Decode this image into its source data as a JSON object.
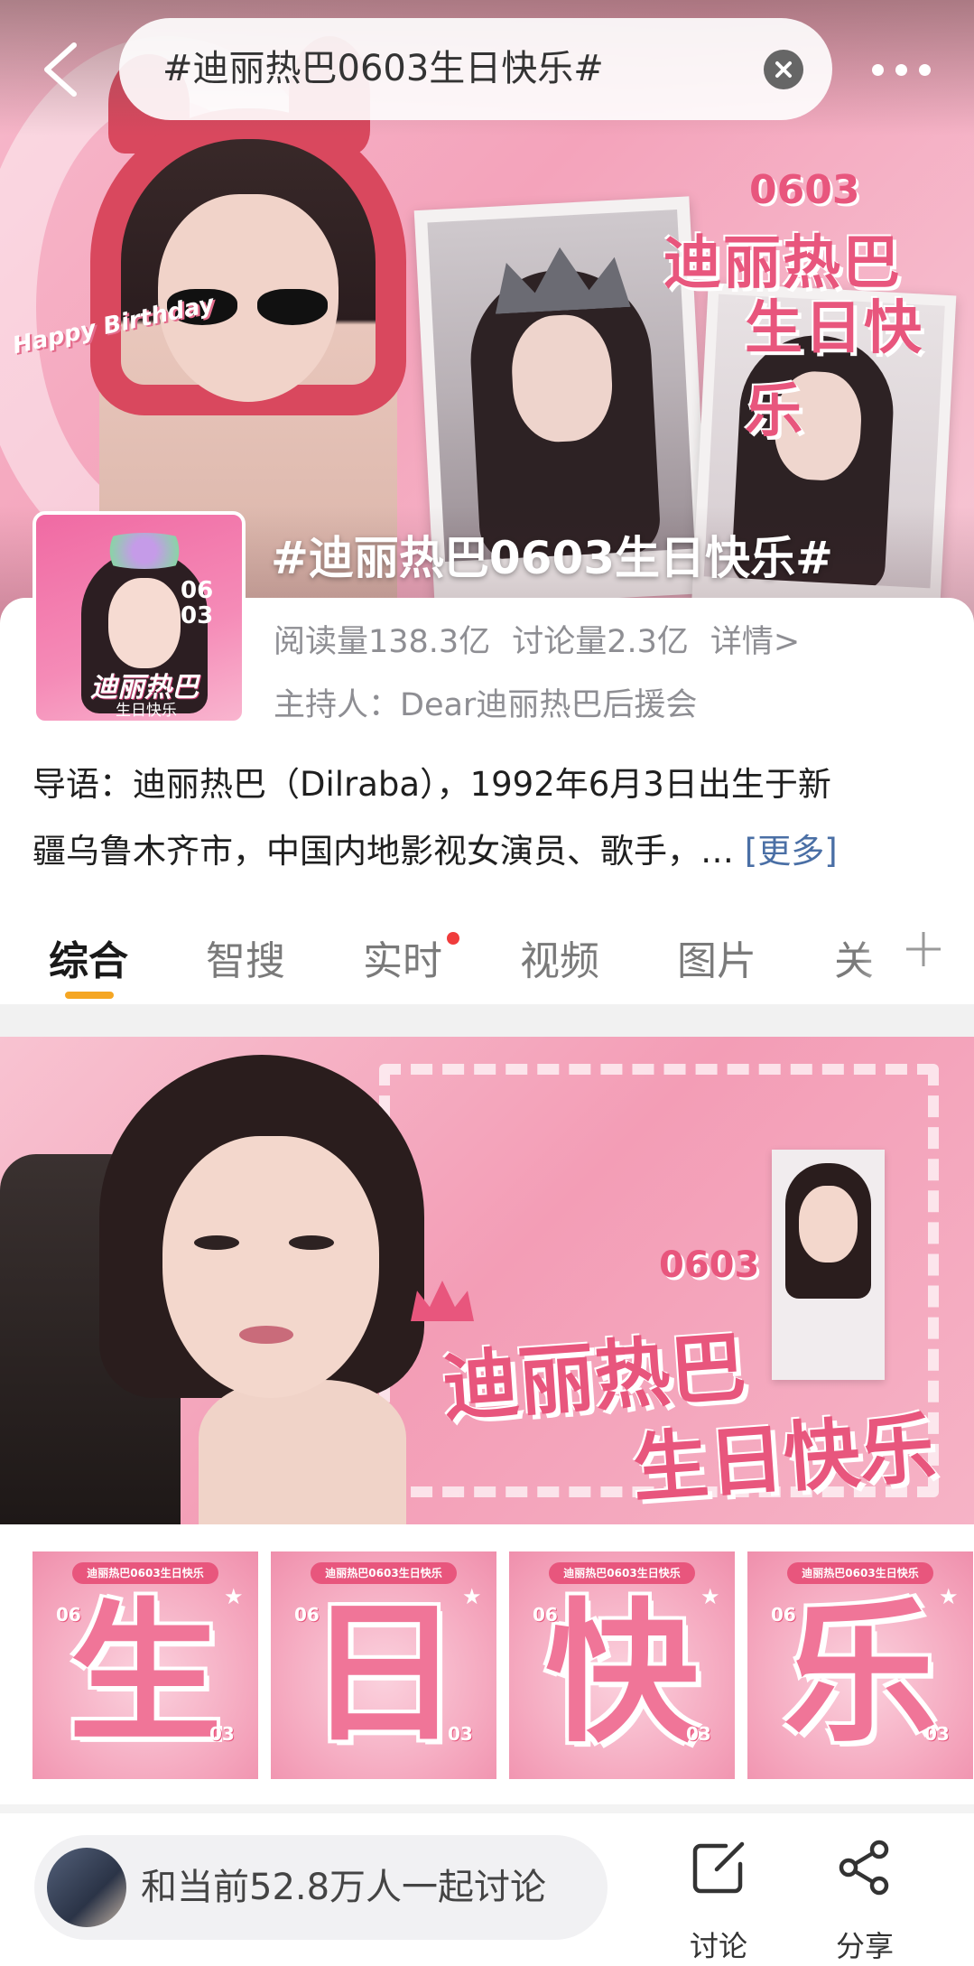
{
  "search": {
    "query": "#迪丽热巴0603生日快乐#"
  },
  "hero": {
    "happy_birthday": "Happy Birthday",
    "number": "0603",
    "title_line1": "迪丽热巴",
    "title_line2": "生日快乐"
  },
  "topic": {
    "title": "#迪丽热巴0603生日快乐#",
    "avatar_number": "06\n03",
    "avatar_name": "迪丽热巴",
    "avatar_sub": "生日快乐",
    "reads": "阅读量138.3亿",
    "discussions": "讨论量2.3亿",
    "details_link": "详情>",
    "host": "主持人：Dear迪丽热巴后援会",
    "intro_line1": "导语：迪丽热巴（Dilraba），1992年6月3日出生于新",
    "intro_line2": "疆乌鲁木齐市，中国内地影视女演员、歌手，…",
    "more_label": "[更多]"
  },
  "tabs": [
    {
      "label": "综合",
      "active": true
    },
    {
      "label": "智搜",
      "active": false
    },
    {
      "label": "实时",
      "active": false,
      "dot": true
    },
    {
      "label": "视频",
      "active": false
    },
    {
      "label": "图片",
      "active": false
    },
    {
      "label": "关",
      "active": false
    }
  ],
  "tab_add": "+",
  "banner": {
    "number": "0603",
    "title_line1": "迪丽热巴",
    "title_line2": "生日快乐"
  },
  "tiles": [
    {
      "caption": "迪丽热巴0603生日快乐",
      "char": "生",
      "n1": "06",
      "n2": "03"
    },
    {
      "caption": "迪丽热巴0603生日快乐",
      "char": "日",
      "n1": "06",
      "n2": "03"
    },
    {
      "caption": "迪丽热巴0603生日快乐",
      "char": "快",
      "n1": "06",
      "n2": "03"
    },
    {
      "caption": "迪丽热巴0603生日快乐",
      "char": "乐",
      "n1": "06",
      "n2": "03"
    }
  ],
  "bottom": {
    "discuss_prompt": "和当前52.8万人一起讨论",
    "discuss_label": "讨论",
    "share_label": "分享"
  },
  "colors": {
    "accent_pink": "#e8567d",
    "tab_indicator": "#f5a623",
    "link_blue": "#4a6fa5",
    "notification_dot": "#f03c3c"
  },
  "icons": [
    "back-arrow-icon",
    "clear-icon",
    "more-icon",
    "edit-icon",
    "share-icon",
    "plus-icon"
  ]
}
